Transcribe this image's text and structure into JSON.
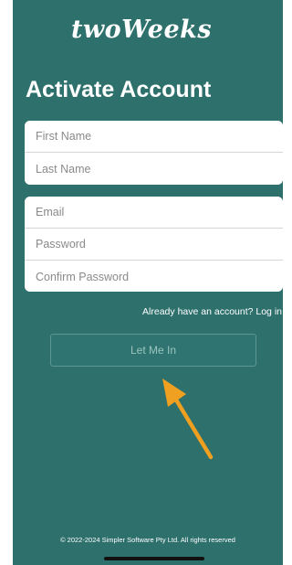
{
  "app": {
    "logo_text": "twoWeeks",
    "title": "Activate Account"
  },
  "form": {
    "first_name_placeholder": "First Name",
    "last_name_placeholder": "Last Name",
    "email_placeholder": "Email",
    "password_placeholder": "Password",
    "confirm_password_placeholder": "Confirm Password"
  },
  "login_link": "Already have an account? Log in",
  "submit_label": "Let Me In",
  "footer": "© 2022-2024 Simpler Software Pty Ltd. All rights reserved",
  "icons": {
    "annotation": "arrow-icon"
  },
  "colors": {
    "background": "#2d706c",
    "annotation_arrow": "#f0a020"
  }
}
